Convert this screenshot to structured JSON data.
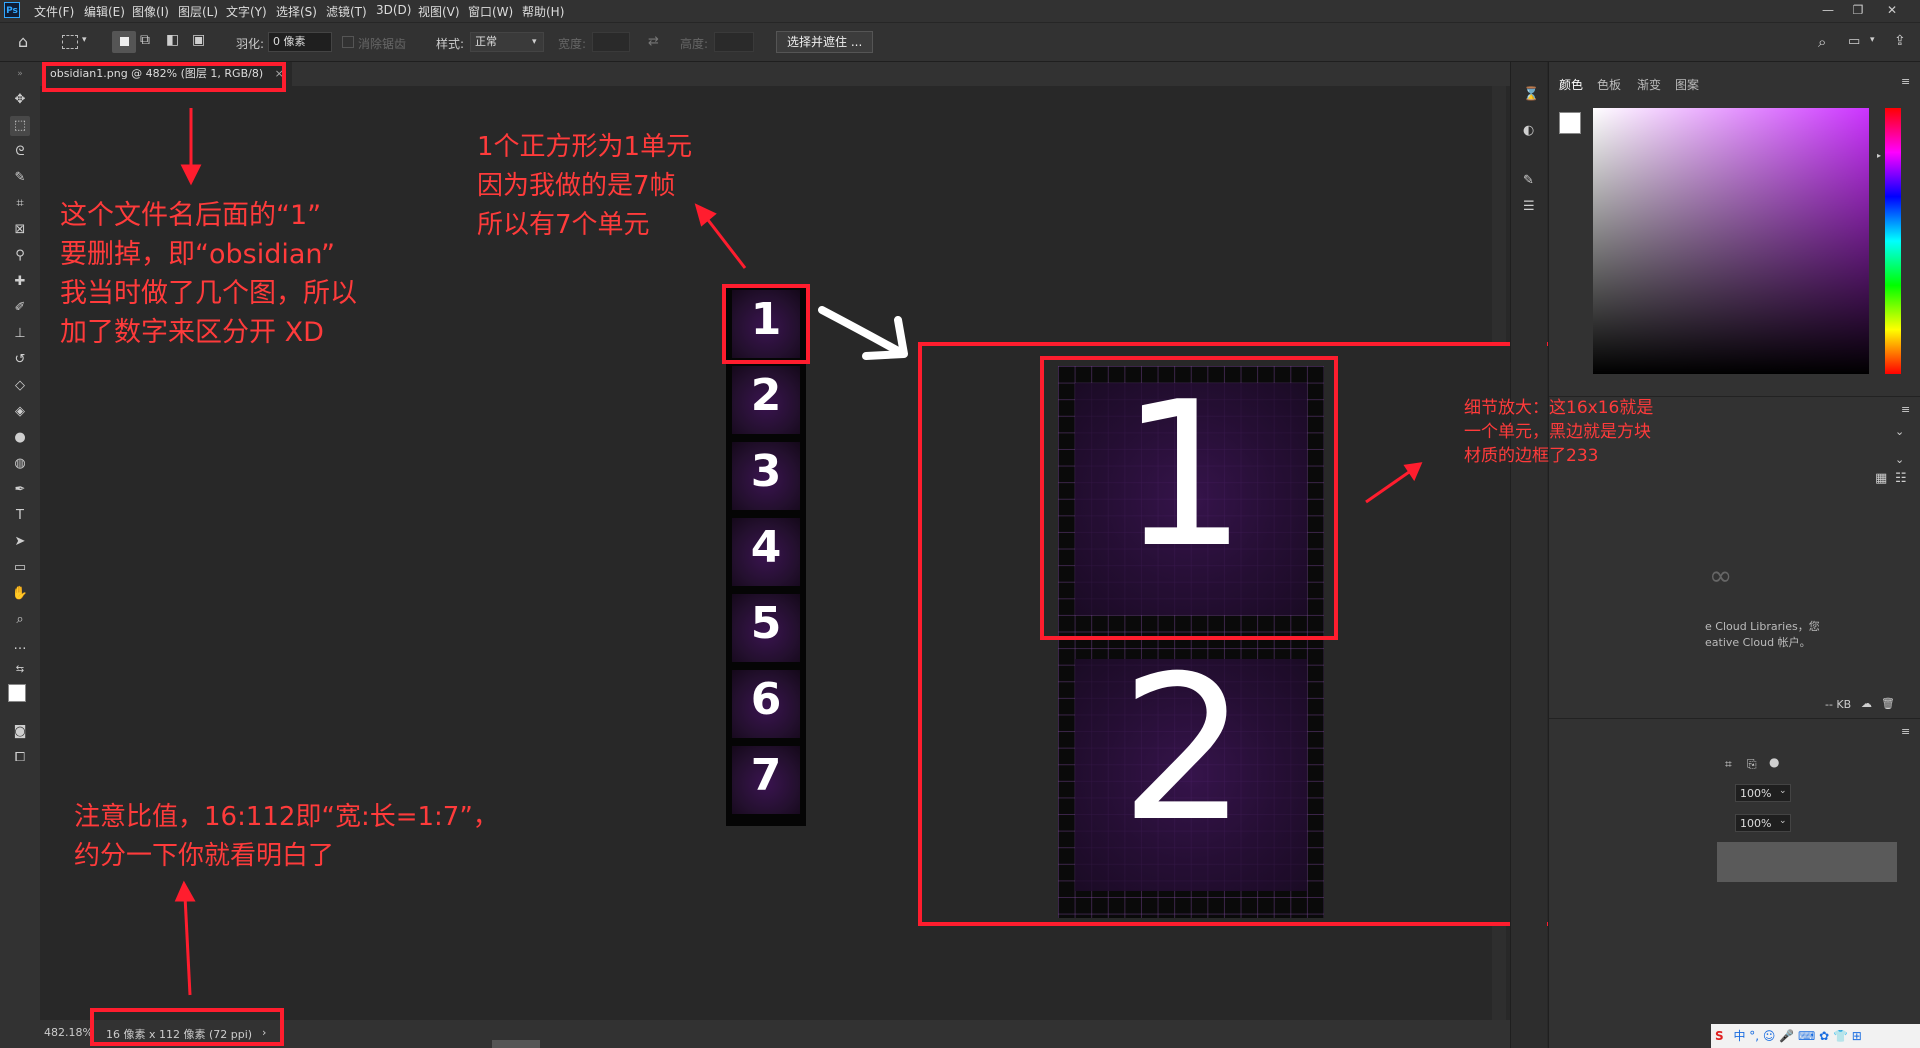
{
  "app": {
    "logo": "Ps"
  },
  "menu": [
    "文件(F)",
    "编辑(E)",
    "图像(I)",
    "图层(L)",
    "文字(Y)",
    "选择(S)",
    "滤镜(T)",
    "3D(D)",
    "视图(V)",
    "窗口(W)",
    "帮助(H)"
  ],
  "options": {
    "feather_label": "羽化:",
    "feather_value": "0 像素",
    "antialias_label": "消除锯齿",
    "style_label": "样式:",
    "style_value": "正常",
    "width_label": "宽度:",
    "height_label": "高度:",
    "select_mask_button": "选择并遮住 ..."
  },
  "document": {
    "tab_title": "obsidian1.png @ 482% (图层 1, RGB/8)",
    "zoom": "482.18%",
    "doc_size": "16 像素 x 112 像素 (72 ppi)"
  },
  "panels": {
    "tabs": [
      "颜色",
      "色板",
      "渐变",
      "图案"
    ],
    "libraries_text_1": "e Cloud Libraries，您",
    "libraries_text_2": "eative Cloud 帐户。",
    "kb_label": "-- KB",
    "opacity_value": "100%",
    "fill_value": "100%"
  },
  "tiles": [
    "1",
    "2",
    "3",
    "4",
    "5",
    "6",
    "7"
  ],
  "zoomed_digits": [
    "1",
    "2"
  ],
  "annotations": {
    "filename_note": [
      "这个文件名后面的“1”",
      "要删掉，即“obsidian”",
      "我当时做了几个图，所以",
      "加了数字来区分开 XD"
    ],
    "unit_note": [
      "1个正方形为1单元",
      "因为我做的是7帧",
      "所以有7个单元"
    ],
    "detail_note": [
      "细节放大：这16x16就是",
      "一个单元，黑边就是方块",
      "材质的边框了233"
    ],
    "ratio_note": [
      "注意比值，16:112即“宽:长=1:7”，",
      "约分一下你就看明白了"
    ]
  },
  "colors": {
    "annotation_red": "#ff1d2e",
    "texture_purple": "#3a1350"
  }
}
